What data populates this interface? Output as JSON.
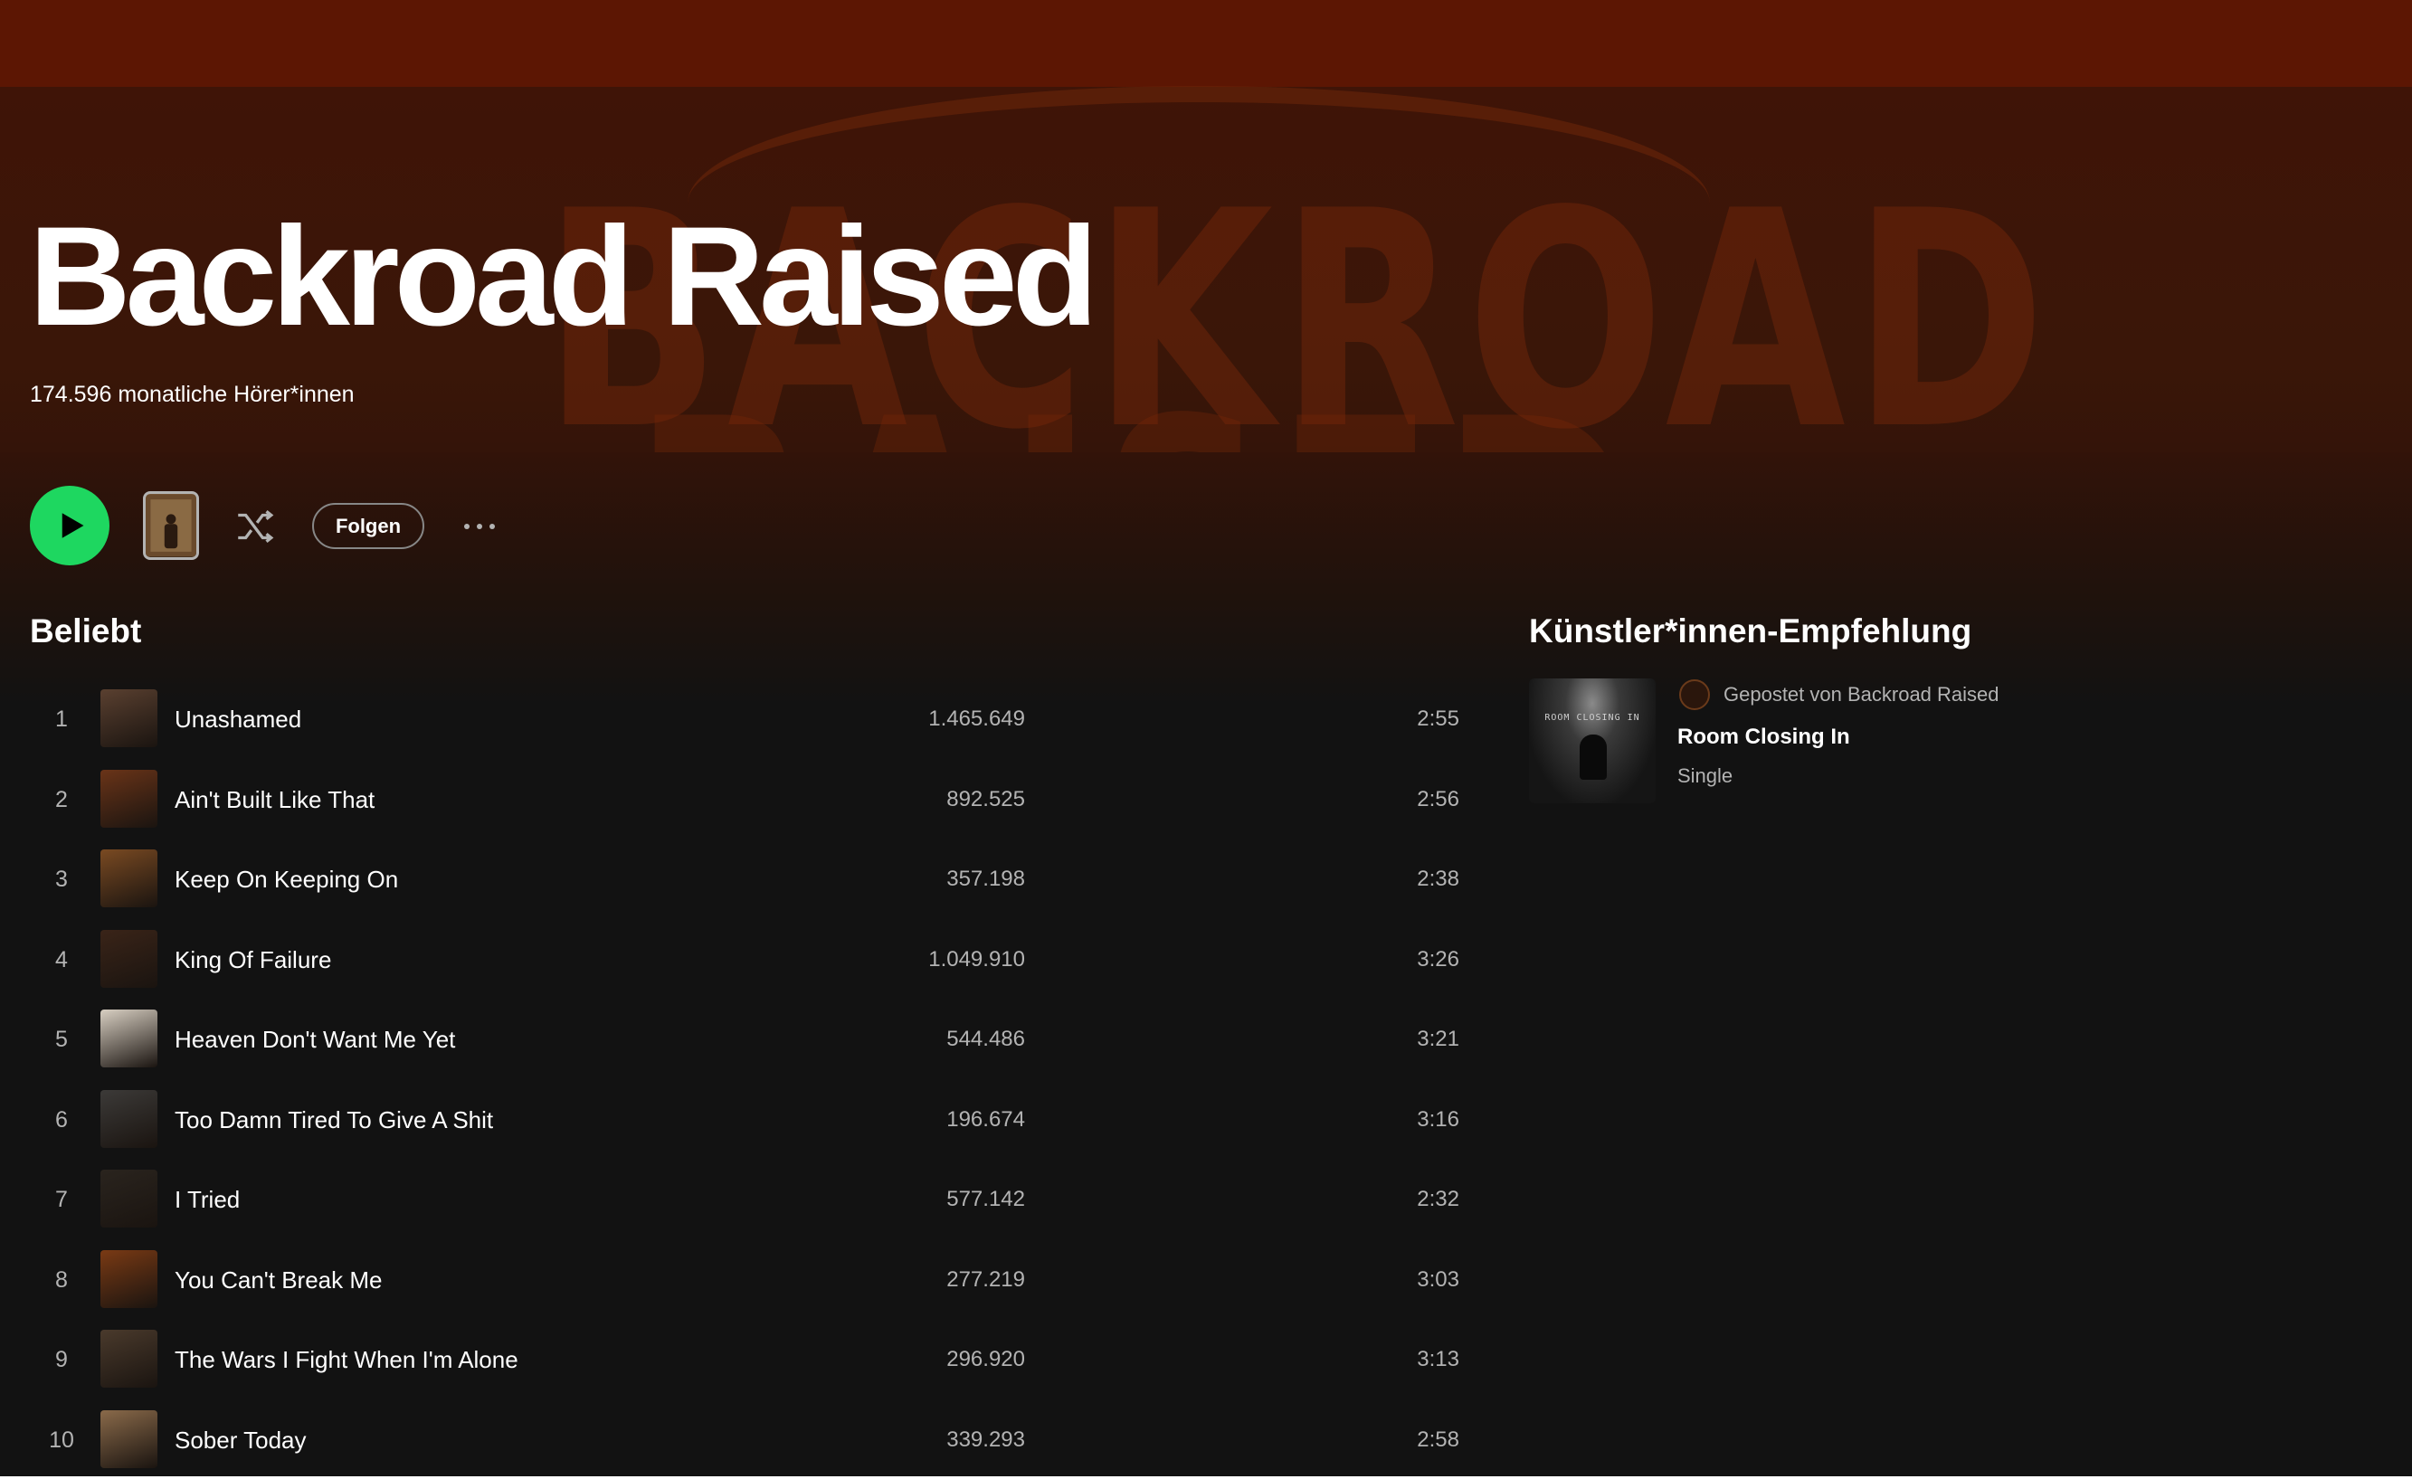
{
  "artist": {
    "name": "Backroad Raised",
    "monthly_listeners": "174.596 monatliche Hörer*innen"
  },
  "actions": {
    "play_icon": "play-icon",
    "shuffle_icon": "shuffle-icon",
    "follow_label": "Folgen",
    "more_icon": "more-options-icon"
  },
  "popular": {
    "title": "Beliebt",
    "tracks": [
      {
        "num": "1",
        "title": "Unashamed",
        "plays": "1.465.649",
        "duration": "2:55",
        "cover_color": "#5a4030"
      },
      {
        "num": "2",
        "title": "Ain't Built Like That",
        "plays": "892.525",
        "duration": "2:56",
        "cover_color": "#6a3418"
      },
      {
        "num": "3",
        "title": "Keep On Keeping On",
        "plays": "357.198",
        "duration": "2:38",
        "cover_color": "#7a4a22"
      },
      {
        "num": "4",
        "title": "King Of Failure",
        "plays": "1.049.910",
        "duration": "3:26",
        "cover_color": "#3a2418"
      },
      {
        "num": "5",
        "title": "Heaven Don't Want Me Yet",
        "plays": "544.486",
        "duration": "3:21",
        "cover_color": "#d8cfc2"
      },
      {
        "num": "6",
        "title": "Too Damn Tired To Give A Shit",
        "plays": "196.674",
        "duration": "3:16",
        "cover_color": "#3c3a38"
      },
      {
        "num": "7",
        "title": "I Tried",
        "plays": "577.142",
        "duration": "2:32",
        "cover_color": "#2a241e"
      },
      {
        "num": "8",
        "title": "You Can't Break Me",
        "plays": "277.219",
        "duration": "3:03",
        "cover_color": "#7a3a14"
      },
      {
        "num": "9",
        "title": "The Wars I Fight When I'm Alone",
        "plays": "296.920",
        "duration": "3:13",
        "cover_color": "#4a3a2c"
      },
      {
        "num": "10",
        "title": "Sober Today",
        "plays": "339.293",
        "duration": "2:58",
        "cover_color": "#8a6a4a"
      }
    ]
  },
  "recommendation": {
    "title": "Künstler*innen-Empfehlung",
    "posted_by": "Gepostet von Backroad Raised",
    "release_name": "Room Closing In",
    "release_type": "Single",
    "cover_text": "ROOM CLOSING IN"
  },
  "colors": {
    "accent_green": "#1ed760",
    "hero_red": "#5c1603",
    "background": "#121212",
    "muted_text": "#b3b3b3"
  }
}
